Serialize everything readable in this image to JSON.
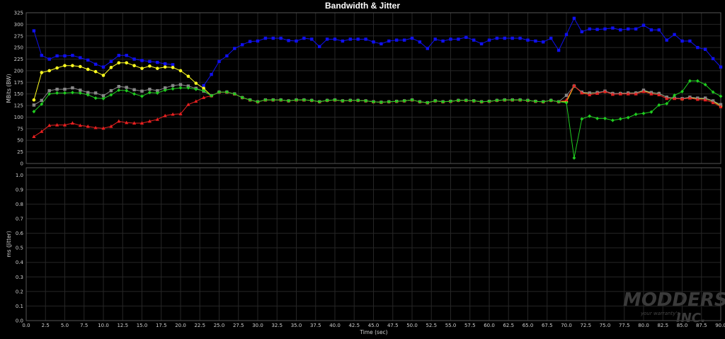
{
  "chart_data": [
    {
      "type": "line",
      "title": "Bandwidth & Jitter",
      "ylabel": "MBits (BW)",
      "ylim": [
        0,
        325
      ],
      "yticks": [
        0,
        25,
        50,
        75,
        100,
        125,
        150,
        175,
        200,
        225,
        250,
        275,
        300,
        325
      ],
      "grid": true,
      "x": [
        1,
        2,
        3,
        4,
        5,
        6,
        7,
        8,
        9,
        10,
        11,
        12,
        13,
        14,
        15,
        16,
        17,
        18,
        19,
        20,
        21,
        22,
        23,
        24,
        25,
        26,
        27,
        28,
        29,
        30,
        31,
        32,
        33,
        34,
        35,
        36,
        37,
        38,
        39,
        40,
        41,
        42,
        43,
        44,
        45,
        46,
        47,
        48,
        49,
        50,
        51,
        52,
        53,
        54,
        55,
        56,
        57,
        58,
        59,
        60,
        61,
        62,
        63,
        64,
        65,
        66,
        67,
        68,
        69,
        70,
        71,
        72,
        73,
        74,
        75,
        76,
        77,
        78,
        79,
        80,
        81,
        82,
        83,
        84,
        85,
        86,
        87,
        88,
        89,
        90
      ],
      "series": [
        {
          "color": "#1010ee",
          "values": [
            286,
            233,
            225,
            232,
            232,
            233,
            228,
            223,
            214,
            208,
            220,
            233,
            233,
            225,
            222,
            220,
            218,
            215,
            213,
            null,
            null,
            null,
            168,
            192,
            220,
            232,
            248,
            256,
            263,
            264,
            270,
            270,
            270,
            265,
            264,
            270,
            268,
            252,
            268,
            268,
            264,
            268,
            268,
            268,
            262,
            258,
            264,
            266,
            266,
            270,
            262,
            248,
            268,
            264,
            268,
            268,
            272,
            266,
            258,
            266,
            270,
            270,
            270,
            270,
            266,
            264,
            262,
            270,
            244,
            278,
            313,
            284,
            290,
            289,
            290,
            292,
            288,
            290,
            290,
            298,
            288,
            288,
            266,
            278,
            264,
            264,
            250,
            246,
            226,
            208
          ]
        },
        {
          "color": "#ffff20",
          "values": [
            137,
            196,
            200,
            206,
            211,
            211,
            209,
            203,
            198,
            190,
            207,
            217,
            217,
            211,
            205,
            210,
            205,
            208,
            207,
            200,
            188,
            173,
            162,
            146,
            154,
            154,
            150,
            142,
            137,
            133,
            137,
            137,
            137,
            135,
            137,
            137,
            136,
            133,
            136,
            137,
            135,
            136,
            136,
            135,
            133,
            132,
            133,
            134,
            135,
            137,
            133,
            131,
            135,
            133,
            134,
            136,
            136,
            135,
            133,
            134,
            136,
            137,
            137,
            137,
            136,
            134,
            133,
            136,
            133,
            133,
            167,
            153,
            151,
            153,
            155,
            151,
            151,
            152,
            152,
            157,
            152,
            151,
            143,
            141,
            139,
            142,
            140,
            140,
            134,
            124
          ]
        },
        {
          "color": "#888888",
          "values": [
            126,
            136,
            157,
            160,
            160,
            163,
            158,
            153,
            152,
            146,
            157,
            166,
            164,
            159,
            156,
            160,
            157,
            163,
            168,
            170,
            167,
            162,
            156,
            146,
            154,
            154,
            150,
            142,
            137,
            133,
            137,
            137,
            137,
            135,
            137,
            137,
            136,
            133,
            136,
            137,
            135,
            136,
            136,
            135,
            133,
            132,
            133,
            134,
            135,
            137,
            133,
            131,
            135,
            133,
            134,
            136,
            136,
            135,
            133,
            134,
            136,
            137,
            137,
            137,
            136,
            134,
            133,
            136,
            133,
            147,
            167,
            154,
            152,
            153,
            156,
            151,
            151,
            152,
            152,
            158,
            153,
            151,
            143,
            141,
            140,
            143,
            141,
            141,
            135,
            127
          ]
        },
        {
          "color": "#e82020",
          "values": [
            58,
            69,
            82,
            83,
            83,
            87,
            82,
            80,
            77,
            76,
            80,
            91,
            88,
            87,
            87,
            91,
            95,
            103,
            106,
            107,
            127,
            134,
            142,
            146,
            154,
            154,
            150,
            142,
            137,
            133,
            137,
            137,
            137,
            135,
            137,
            137,
            136,
            133,
            136,
            137,
            135,
            136,
            136,
            135,
            133,
            132,
            133,
            134,
            135,
            137,
            133,
            131,
            135,
            133,
            134,
            136,
            136,
            135,
            133,
            134,
            136,
            137,
            137,
            137,
            136,
            134,
            133,
            136,
            133,
            137,
            168,
            152,
            148,
            151,
            155,
            149,
            150,
            150,
            150,
            155,
            150,
            148,
            140,
            140,
            139,
            141,
            138,
            137,
            131,
            122
          ]
        },
        {
          "color": "#20cc20",
          "values": [
            112,
            128,
            150,
            152,
            152,
            153,
            152,
            148,
            141,
            140,
            148,
            158,
            157,
            150,
            145,
            153,
            152,
            158,
            161,
            163,
            163,
            160,
            157,
            146,
            154,
            154,
            150,
            142,
            137,
            133,
            137,
            137,
            137,
            135,
            137,
            137,
            136,
            133,
            136,
            137,
            135,
            136,
            136,
            135,
            133,
            132,
            133,
            134,
            135,
            137,
            133,
            131,
            135,
            133,
            134,
            136,
            136,
            135,
            133,
            134,
            136,
            137,
            137,
            137,
            136,
            134,
            133,
            136,
            133,
            131,
            12,
            96,
            102,
            97,
            97,
            93,
            96,
            99,
            106,
            108,
            111,
            126,
            129,
            147,
            155,
            178,
            178,
            170,
            154,
            145
          ]
        }
      ]
    },
    {
      "type": "line",
      "xlabel": "Time (sec)",
      "ylabel": "ms (Jitter)",
      "xlim": [
        0,
        90
      ],
      "xticks": [
        "0.0",
        "2.5",
        "5.0",
        "7.5",
        "10.0",
        "12.5",
        "15.0",
        "17.5",
        "20.0",
        "22.5",
        "25.0",
        "27.5",
        "30.0",
        "32.5",
        "35.0",
        "37.5",
        "40.0",
        "42.5",
        "45.0",
        "47.5",
        "50.0",
        "52.5",
        "55.0",
        "57.5",
        "60.0",
        "62.5",
        "65.0",
        "67.5",
        "70.0",
        "72.5",
        "75.0",
        "77.5",
        "80.0",
        "82.5",
        "85.0",
        "87.5",
        "90.0"
      ],
      "ylim": [
        0,
        1.05
      ],
      "yticks": [
        "0.0",
        "0.1",
        "0.2",
        "0.3",
        "0.4",
        "0.5",
        "0.6",
        "0.7",
        "0.8",
        "0.9",
        "1.0"
      ],
      "grid": true,
      "series": []
    }
  ],
  "watermark": {
    "line1": "MODDERS",
    "line2": "INC.",
    "line3": "your warranty's"
  }
}
